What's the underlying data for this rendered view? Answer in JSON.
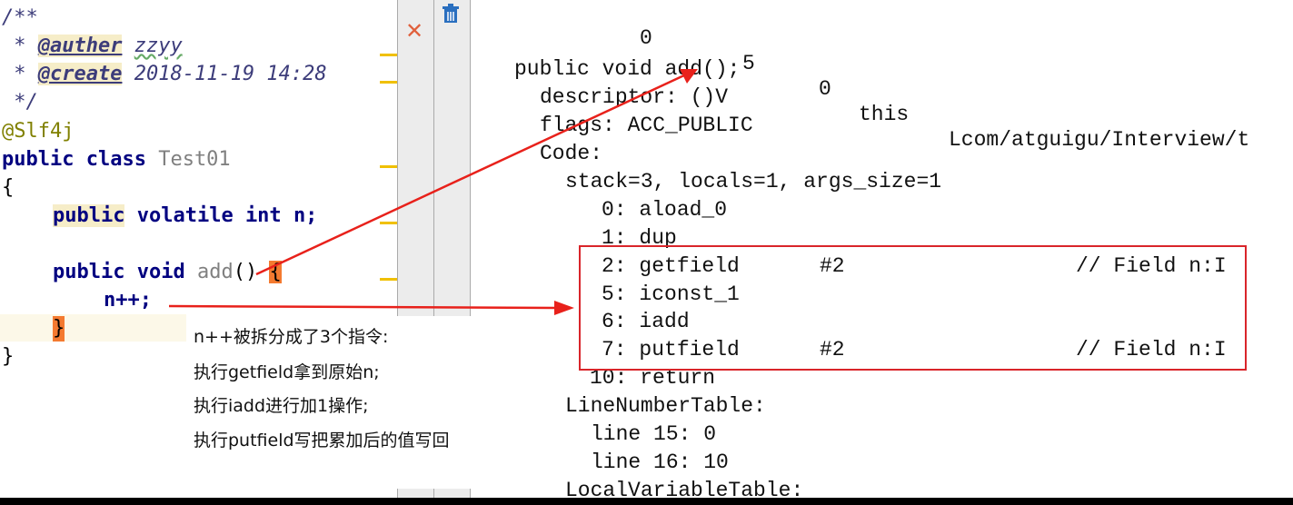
{
  "editor": {
    "lines": [
      {
        "text": "/**"
      },
      {
        "prefix": " * ",
        "tag": "@auther",
        "value": "zzyy"
      },
      {
        "prefix": " * ",
        "tag": "@create",
        "value": "2018-11-19 14:28"
      },
      {
        "text": " */"
      },
      {
        "text": "@Slf4j"
      },
      {
        "kw": "public class",
        "name": "Test01"
      },
      {
        "text": "{"
      },
      {
        "kw1": "public",
        "kw2": "volatile int",
        "rest": "n;"
      },
      {
        "kw": "public void",
        "name": "add",
        "rest": "()",
        "brace": "{"
      },
      {
        "text": "n++;"
      },
      {
        "text": "}"
      },
      {
        "text": "}"
      }
    ]
  },
  "toolbar": {
    "close_icon": "close-x-icon",
    "delete_icon": "trash-icon"
  },
  "bytecode": {
    "header_row": {
      "start": "0",
      "length": "5",
      "slot": "0",
      "name": "this",
      "signature": "Lcom/atguigu/Interview/t"
    },
    "method": "public void add();",
    "descriptor": "descriptor: ()V",
    "flags": "flags: ACC_PUBLIC",
    "code": "Code:",
    "stack": "stack=3, locals=1, args_size=1",
    "instructions": [
      {
        "offset": "0:",
        "op": "aload_0",
        "arg": "",
        "comment": ""
      },
      {
        "offset": "1:",
        "op": "dup",
        "arg": "",
        "comment": ""
      },
      {
        "offset": "2:",
        "op": "getfield",
        "arg": "#2",
        "comment": "// Field n:I"
      },
      {
        "offset": "5:",
        "op": "iconst_1",
        "arg": "",
        "comment": ""
      },
      {
        "offset": "6:",
        "op": "iadd",
        "arg": "",
        "comment": ""
      },
      {
        "offset": "7:",
        "op": "putfield",
        "arg": "#2",
        "comment": "// Field n:I"
      },
      {
        "offset": "10:",
        "op": "return",
        "arg": "",
        "comment": ""
      }
    ],
    "line_number_table": "LineNumberTable:",
    "line_entries": [
      "line 15: 0",
      "line 16: 10"
    ],
    "local_variable_table": "LocalVariableTable:"
  },
  "annotation": {
    "lines": [
      "n++被拆分成了3个指令:",
      "执行getfield拿到原始n;",
      "执行iadd进行加1操作;",
      "执行putfield写把累加后的值写回"
    ]
  },
  "colors": {
    "arrow": "#e8211b",
    "box": "#d9252a",
    "marker": "#f0c000",
    "brace_highlight": "#f47a30"
  }
}
